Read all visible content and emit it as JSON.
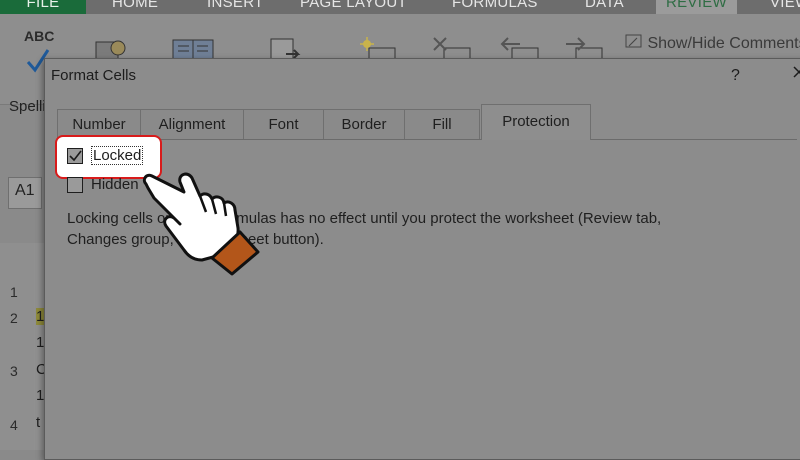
{
  "ribbon_tabs": [
    "FILE",
    "HOME",
    "INSERT",
    "PAGE LAYOUT",
    "FORMULAS",
    "DATA",
    "REVIEW",
    "VIEW"
  ],
  "ribbon": {
    "spelling_abc": "ABC",
    "spelling_label": "Spelling",
    "show_hide_comments": "Show/Hide Comments"
  },
  "name_box": "A1",
  "row_headers": [
    "1",
    "2",
    "3",
    "4"
  ],
  "cell_fragments": [
    "1",
    "1",
    "C",
    "1",
    "t"
  ],
  "dialog": {
    "title": "Format Cells",
    "help": "?",
    "close": "X",
    "tabs": [
      "Number",
      "Alignment",
      "Font",
      "Border",
      "Fill",
      "Protection"
    ],
    "active_tab": "Protection",
    "locked_label": "Locked",
    "locked_checked": true,
    "hidden_label": "Hidden",
    "hidden_checked": false,
    "note_line1": "Locking cells or hiding formulas has no effect until you protect the worksheet (Review tab,",
    "note_line2": "Changes group, Protect Sheet button)."
  }
}
